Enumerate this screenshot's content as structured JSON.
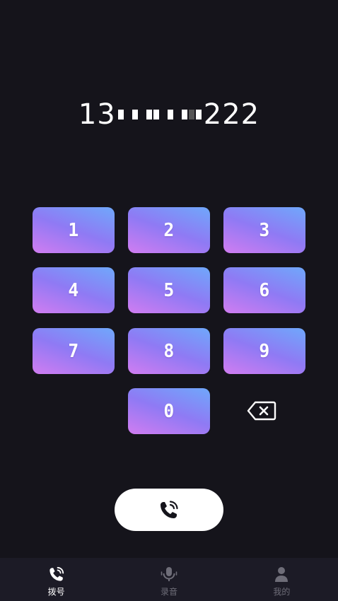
{
  "dialer": {
    "number_prefix": "13",
    "number_suffix": "222"
  },
  "keypad": {
    "keys": [
      "1",
      "2",
      "3",
      "4",
      "5",
      "6",
      "7",
      "8",
      "9",
      "0"
    ]
  },
  "icons": {
    "backspace": "backspace-icon",
    "call": "phone-icon"
  },
  "tabbar": {
    "tabs": [
      {
        "label": "拨号",
        "icon": "phone-icon",
        "active": true
      },
      {
        "label": "录音",
        "icon": "microphone-icon",
        "active": false
      },
      {
        "label": "我的",
        "icon": "user-icon",
        "active": false
      }
    ]
  },
  "colors": {
    "background": "#15141b",
    "tabbar": "#1c1b26",
    "key_gradient_start": "#d17cf1",
    "key_gradient_end": "#6fa8fb",
    "active_tab": "#ffffff",
    "inactive_tab": "#6e6d78"
  }
}
